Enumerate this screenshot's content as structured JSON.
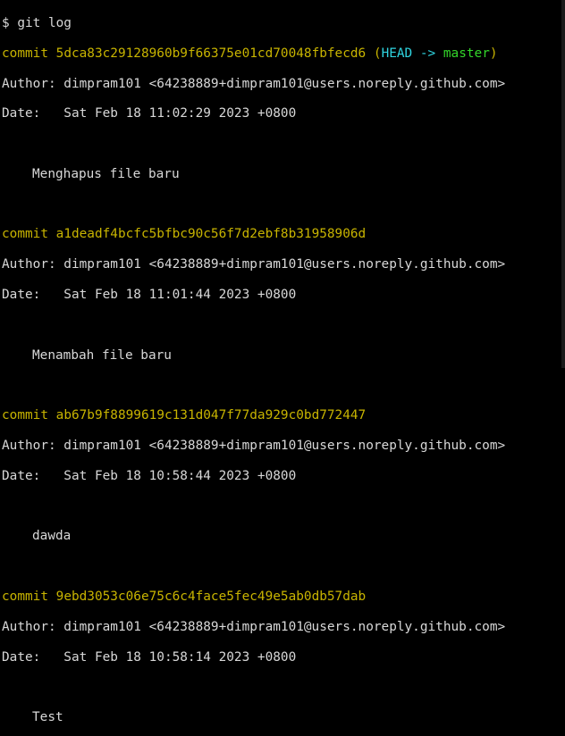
{
  "prompt": "$ git log",
  "commits": [
    {
      "keyword": "commit",
      "hash": "5dca83c29128960b9f66375e01cd70048fbfecd6",
      "refs_open": "(",
      "refs_head": "HEAD -> ",
      "refs_branch": "master",
      "refs_close": ")",
      "author_line": "Author: dimpram101 <64238889+dimpram101@users.noreply.github.com>",
      "date_line": "Date:   Sat Feb 18 11:02:29 2023 +0800",
      "message": "Menghapus file baru"
    },
    {
      "keyword": "commit",
      "hash": "a1deadf4bcfc5bfbc90c56f7d2ebf8b31958906d",
      "author_line": "Author: dimpram101 <64238889+dimpram101@users.noreply.github.com>",
      "date_line": "Date:   Sat Feb 18 11:01:44 2023 +0800",
      "message": "Menambah file baru"
    },
    {
      "keyword": "commit",
      "hash": "ab67b9f8899619c131d047f77da929c0bd772447",
      "author_line": "Author: dimpram101 <64238889+dimpram101@users.noreply.github.com>",
      "date_line": "Date:   Sat Feb 18 10:58:44 2023 +0800",
      "message": "dawda"
    },
    {
      "keyword": "commit",
      "hash": "9ebd3053c06e75c6c4face5fec49e5ab0db57dab",
      "author_line": "Author: dimpram101 <64238889+dimpram101@users.noreply.github.com>",
      "date_line": "Date:   Sat Feb 18 10:58:14 2023 +0800",
      "message": "Test"
    }
  ],
  "colors": {
    "background": "#000000",
    "text": "#d8d8d8",
    "commit_yellow": "#c8b400",
    "head_cyan": "#2fd4e0",
    "branch_green": "#33d62a"
  }
}
